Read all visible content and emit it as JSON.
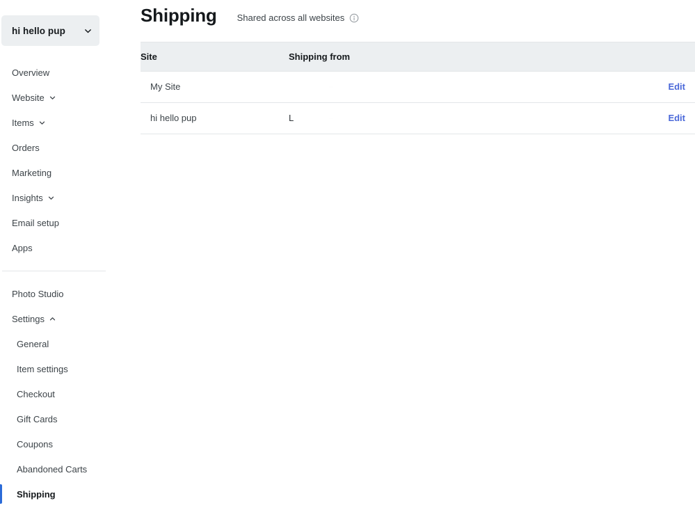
{
  "sidebar": {
    "site_switcher": {
      "label": "hi hello pup",
      "icon": "chevron-down-icon"
    },
    "primary_items": [
      {
        "label": "Overview",
        "has_chevron": false,
        "chevron": ""
      },
      {
        "label": "Website",
        "has_chevron": true,
        "chevron": "chevron-down-icon"
      },
      {
        "label": "Items",
        "has_chevron": true,
        "chevron": "chevron-down-icon"
      },
      {
        "label": "Orders",
        "has_chevron": false,
        "chevron": ""
      },
      {
        "label": "Marketing",
        "has_chevron": false,
        "chevron": ""
      },
      {
        "label": "Insights",
        "has_chevron": true,
        "chevron": "chevron-down-icon"
      },
      {
        "label": "Email setup",
        "has_chevron": false,
        "chevron": ""
      },
      {
        "label": "Apps",
        "has_chevron": false,
        "chevron": ""
      }
    ],
    "secondary_items": [
      {
        "label": "Photo Studio",
        "has_chevron": false,
        "chevron": ""
      },
      {
        "label": "Settings",
        "has_chevron": true,
        "chevron": "chevron-up-icon"
      }
    ],
    "settings_children": [
      {
        "label": "General",
        "active": false
      },
      {
        "label": "Item settings",
        "active": false
      },
      {
        "label": "Checkout",
        "active": false
      },
      {
        "label": "Gift Cards",
        "active": false
      },
      {
        "label": "Coupons",
        "active": false
      },
      {
        "label": "Abandoned Carts",
        "active": false
      },
      {
        "label": "Shipping",
        "active": true
      }
    ],
    "active_indicator_color": "#2b6bd8"
  },
  "header": {
    "title": "Shipping",
    "shared_note": "Shared across all websites",
    "info_icon": "info-circle-icon"
  },
  "table": {
    "columns": [
      "Site",
      "Shipping from",
      ""
    ],
    "rows": [
      {
        "site": "My Site",
        "shipping_from_letter": "",
        "shipping_from_faint": "–",
        "action": "Edit"
      },
      {
        "site": "hi hello pup",
        "shipping_from_letter": "L",
        "shipping_from_faint": "–",
        "action": "Edit"
      }
    ],
    "header_background": "#eceff1",
    "link_color": "#4a68d9"
  }
}
